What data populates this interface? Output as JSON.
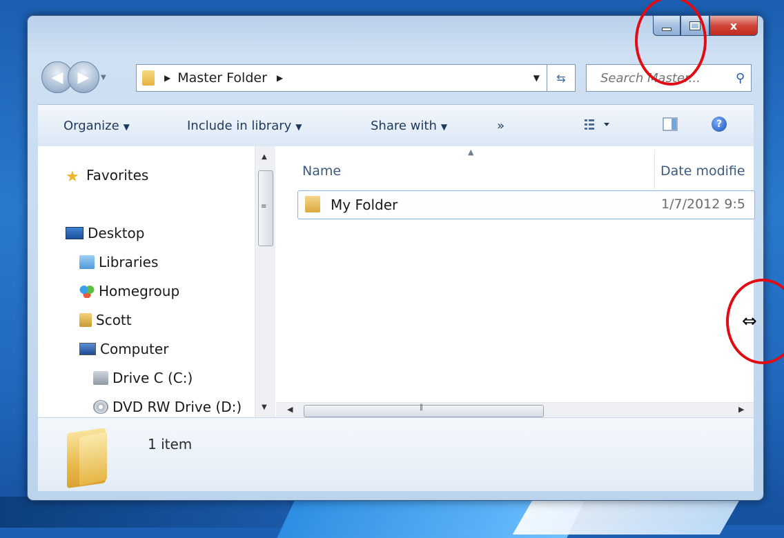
{
  "window": {
    "controls": {
      "minimize": "",
      "maximize": "",
      "close": "x"
    }
  },
  "address_bar": {
    "path": "Master Folder",
    "separator": "▶"
  },
  "search": {
    "placeholder": "Search Master..."
  },
  "toolbar": {
    "organize": "Organize",
    "include_in_library": "Include in library",
    "share_with": "Share with",
    "more": "»",
    "dropdown_arrow": "▼"
  },
  "nav_pane": {
    "items": [
      {
        "label": "Favorites",
        "icon": "star-icon"
      },
      {
        "label": "Desktop",
        "icon": "desktop-icon"
      },
      {
        "label": "Libraries",
        "icon": "libraries-icon"
      },
      {
        "label": "Homegroup",
        "icon": "homegroup-icon"
      },
      {
        "label": "Scott",
        "icon": "user-folder-icon"
      },
      {
        "label": "Computer",
        "icon": "computer-icon"
      },
      {
        "label": "Drive C (C:)",
        "icon": "drive-icon"
      },
      {
        "label": "DVD RW Drive (D:)",
        "icon": "dvd-drive-icon"
      }
    ]
  },
  "file_list": {
    "columns": [
      "Name",
      "Date modifie"
    ],
    "rows": [
      {
        "name": "My Folder",
        "date": "1/7/2012 9:5"
      }
    ]
  },
  "details_pane": {
    "item_count": "1 item"
  },
  "colors": {
    "annotation": "#e10b14",
    "accent": "#1e395b"
  }
}
